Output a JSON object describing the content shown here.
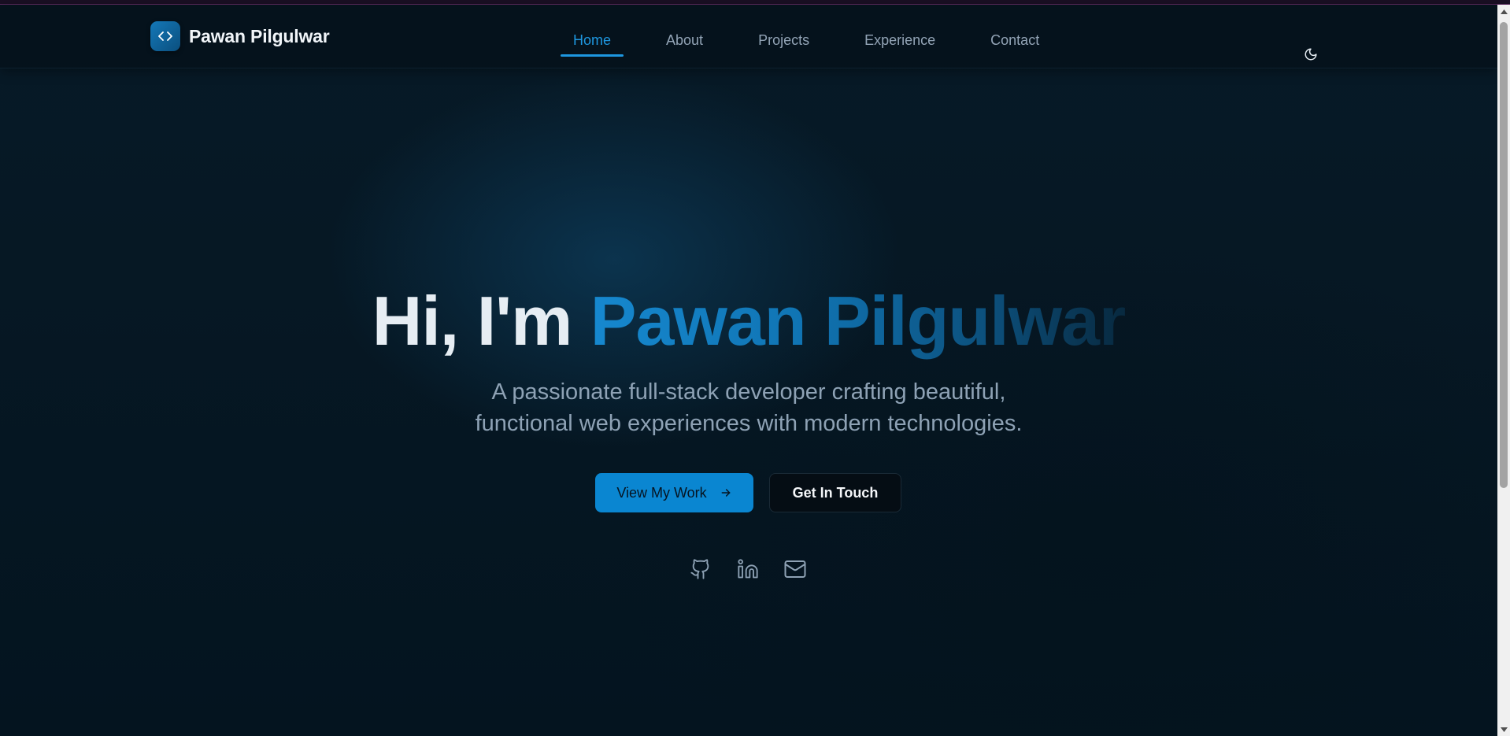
{
  "navbar": {
    "brand_logo_icon": "code-brackets-icon",
    "brand_name": "Pawan Pilgulwar",
    "links": [
      {
        "label": "Home",
        "active": true
      },
      {
        "label": "About",
        "active": false
      },
      {
        "label": "Projects",
        "active": false
      },
      {
        "label": "Experience",
        "active": false
      },
      {
        "label": "Contact",
        "active": false
      }
    ],
    "theme_toggle_icon": "moon-icon"
  },
  "hero": {
    "greeting": "Hi, I'm",
    "name": "Pawan Pilgulwar",
    "subtitle_line1": "A passionate full-stack developer crafting beautiful,",
    "subtitle_line2": "functional web experiences with modern technologies.",
    "primary_button": "View My Work",
    "primary_button_icon": "arrow-right-icon",
    "secondary_button": "Get In Touch",
    "socials": [
      {
        "icon": "github-icon"
      },
      {
        "icon": "linkedin-icon"
      },
      {
        "icon": "mail-icon"
      }
    ]
  },
  "colors": {
    "accent": "#0a86d1",
    "background": "#061722",
    "text_primary": "#e6edf3",
    "text_muted": "#8ea2b5"
  }
}
